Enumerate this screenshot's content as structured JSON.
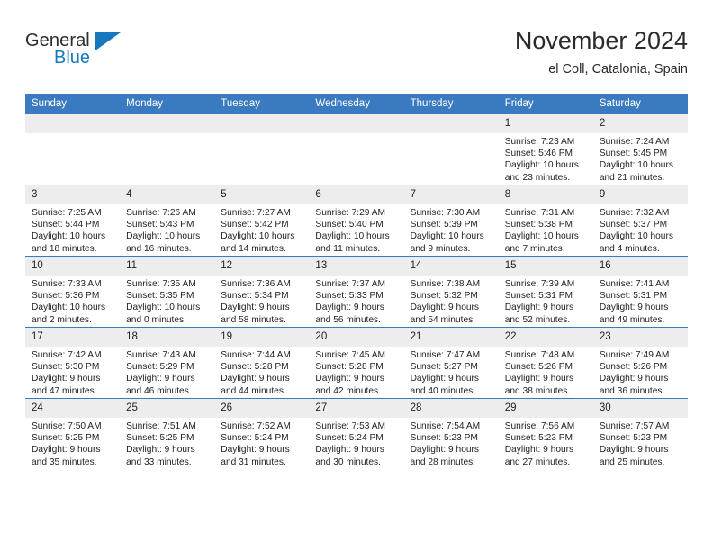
{
  "brand": {
    "name_part1": "General",
    "name_part2": "Blue",
    "accent_color": "#1878be"
  },
  "header": {
    "title": "November 2024",
    "location": "el Coll, Catalonia, Spain"
  },
  "theme": {
    "header_row_color": "#3a7ac0",
    "daynum_band_color": "#ededed",
    "text_color": "#222222"
  },
  "weekdays": [
    "Sunday",
    "Monday",
    "Tuesday",
    "Wednesday",
    "Thursday",
    "Friday",
    "Saturday"
  ],
  "labels": {
    "sunrise_prefix": "Sunrise:",
    "sunset_prefix": "Sunset:",
    "daylight_prefix": "Daylight:"
  },
  "weeks": [
    [
      {
        "day": "",
        "sunrise": "",
        "sunset": "",
        "daylight": ""
      },
      {
        "day": "",
        "sunrise": "",
        "sunset": "",
        "daylight": ""
      },
      {
        "day": "",
        "sunrise": "",
        "sunset": "",
        "daylight": ""
      },
      {
        "day": "",
        "sunrise": "",
        "sunset": "",
        "daylight": ""
      },
      {
        "day": "",
        "sunrise": "",
        "sunset": "",
        "daylight": ""
      },
      {
        "day": "1",
        "sunrise": "Sunrise: 7:23 AM",
        "sunset": "Sunset: 5:46 PM",
        "daylight": "Daylight: 10 hours and 23 minutes."
      },
      {
        "day": "2",
        "sunrise": "Sunrise: 7:24 AM",
        "sunset": "Sunset: 5:45 PM",
        "daylight": "Daylight: 10 hours and 21 minutes."
      }
    ],
    [
      {
        "day": "3",
        "sunrise": "Sunrise: 7:25 AM",
        "sunset": "Sunset: 5:44 PM",
        "daylight": "Daylight: 10 hours and 18 minutes."
      },
      {
        "day": "4",
        "sunrise": "Sunrise: 7:26 AM",
        "sunset": "Sunset: 5:43 PM",
        "daylight": "Daylight: 10 hours and 16 minutes."
      },
      {
        "day": "5",
        "sunrise": "Sunrise: 7:27 AM",
        "sunset": "Sunset: 5:42 PM",
        "daylight": "Daylight: 10 hours and 14 minutes."
      },
      {
        "day": "6",
        "sunrise": "Sunrise: 7:29 AM",
        "sunset": "Sunset: 5:40 PM",
        "daylight": "Daylight: 10 hours and 11 minutes."
      },
      {
        "day": "7",
        "sunrise": "Sunrise: 7:30 AM",
        "sunset": "Sunset: 5:39 PM",
        "daylight": "Daylight: 10 hours and 9 minutes."
      },
      {
        "day": "8",
        "sunrise": "Sunrise: 7:31 AM",
        "sunset": "Sunset: 5:38 PM",
        "daylight": "Daylight: 10 hours and 7 minutes."
      },
      {
        "day": "9",
        "sunrise": "Sunrise: 7:32 AM",
        "sunset": "Sunset: 5:37 PM",
        "daylight": "Daylight: 10 hours and 4 minutes."
      }
    ],
    [
      {
        "day": "10",
        "sunrise": "Sunrise: 7:33 AM",
        "sunset": "Sunset: 5:36 PM",
        "daylight": "Daylight: 10 hours and 2 minutes."
      },
      {
        "day": "11",
        "sunrise": "Sunrise: 7:35 AM",
        "sunset": "Sunset: 5:35 PM",
        "daylight": "Daylight: 10 hours and 0 minutes."
      },
      {
        "day": "12",
        "sunrise": "Sunrise: 7:36 AM",
        "sunset": "Sunset: 5:34 PM",
        "daylight": "Daylight: 9 hours and 58 minutes."
      },
      {
        "day": "13",
        "sunrise": "Sunrise: 7:37 AM",
        "sunset": "Sunset: 5:33 PM",
        "daylight": "Daylight: 9 hours and 56 minutes."
      },
      {
        "day": "14",
        "sunrise": "Sunrise: 7:38 AM",
        "sunset": "Sunset: 5:32 PM",
        "daylight": "Daylight: 9 hours and 54 minutes."
      },
      {
        "day": "15",
        "sunrise": "Sunrise: 7:39 AM",
        "sunset": "Sunset: 5:31 PM",
        "daylight": "Daylight: 9 hours and 52 minutes."
      },
      {
        "day": "16",
        "sunrise": "Sunrise: 7:41 AM",
        "sunset": "Sunset: 5:31 PM",
        "daylight": "Daylight: 9 hours and 49 minutes."
      }
    ],
    [
      {
        "day": "17",
        "sunrise": "Sunrise: 7:42 AM",
        "sunset": "Sunset: 5:30 PM",
        "daylight": "Daylight: 9 hours and 47 minutes."
      },
      {
        "day": "18",
        "sunrise": "Sunrise: 7:43 AM",
        "sunset": "Sunset: 5:29 PM",
        "daylight": "Daylight: 9 hours and 46 minutes."
      },
      {
        "day": "19",
        "sunrise": "Sunrise: 7:44 AM",
        "sunset": "Sunset: 5:28 PM",
        "daylight": "Daylight: 9 hours and 44 minutes."
      },
      {
        "day": "20",
        "sunrise": "Sunrise: 7:45 AM",
        "sunset": "Sunset: 5:28 PM",
        "daylight": "Daylight: 9 hours and 42 minutes."
      },
      {
        "day": "21",
        "sunrise": "Sunrise: 7:47 AM",
        "sunset": "Sunset: 5:27 PM",
        "daylight": "Daylight: 9 hours and 40 minutes."
      },
      {
        "day": "22",
        "sunrise": "Sunrise: 7:48 AM",
        "sunset": "Sunset: 5:26 PM",
        "daylight": "Daylight: 9 hours and 38 minutes."
      },
      {
        "day": "23",
        "sunrise": "Sunrise: 7:49 AM",
        "sunset": "Sunset: 5:26 PM",
        "daylight": "Daylight: 9 hours and 36 minutes."
      }
    ],
    [
      {
        "day": "24",
        "sunrise": "Sunrise: 7:50 AM",
        "sunset": "Sunset: 5:25 PM",
        "daylight": "Daylight: 9 hours and 35 minutes."
      },
      {
        "day": "25",
        "sunrise": "Sunrise: 7:51 AM",
        "sunset": "Sunset: 5:25 PM",
        "daylight": "Daylight: 9 hours and 33 minutes."
      },
      {
        "day": "26",
        "sunrise": "Sunrise: 7:52 AM",
        "sunset": "Sunset: 5:24 PM",
        "daylight": "Daylight: 9 hours and 31 minutes."
      },
      {
        "day": "27",
        "sunrise": "Sunrise: 7:53 AM",
        "sunset": "Sunset: 5:24 PM",
        "daylight": "Daylight: 9 hours and 30 minutes."
      },
      {
        "day": "28",
        "sunrise": "Sunrise: 7:54 AM",
        "sunset": "Sunset: 5:23 PM",
        "daylight": "Daylight: 9 hours and 28 minutes."
      },
      {
        "day": "29",
        "sunrise": "Sunrise: 7:56 AM",
        "sunset": "Sunset: 5:23 PM",
        "daylight": "Daylight: 9 hours and 27 minutes."
      },
      {
        "day": "30",
        "sunrise": "Sunrise: 7:57 AM",
        "sunset": "Sunset: 5:23 PM",
        "daylight": "Daylight: 9 hours and 25 minutes."
      }
    ]
  ]
}
